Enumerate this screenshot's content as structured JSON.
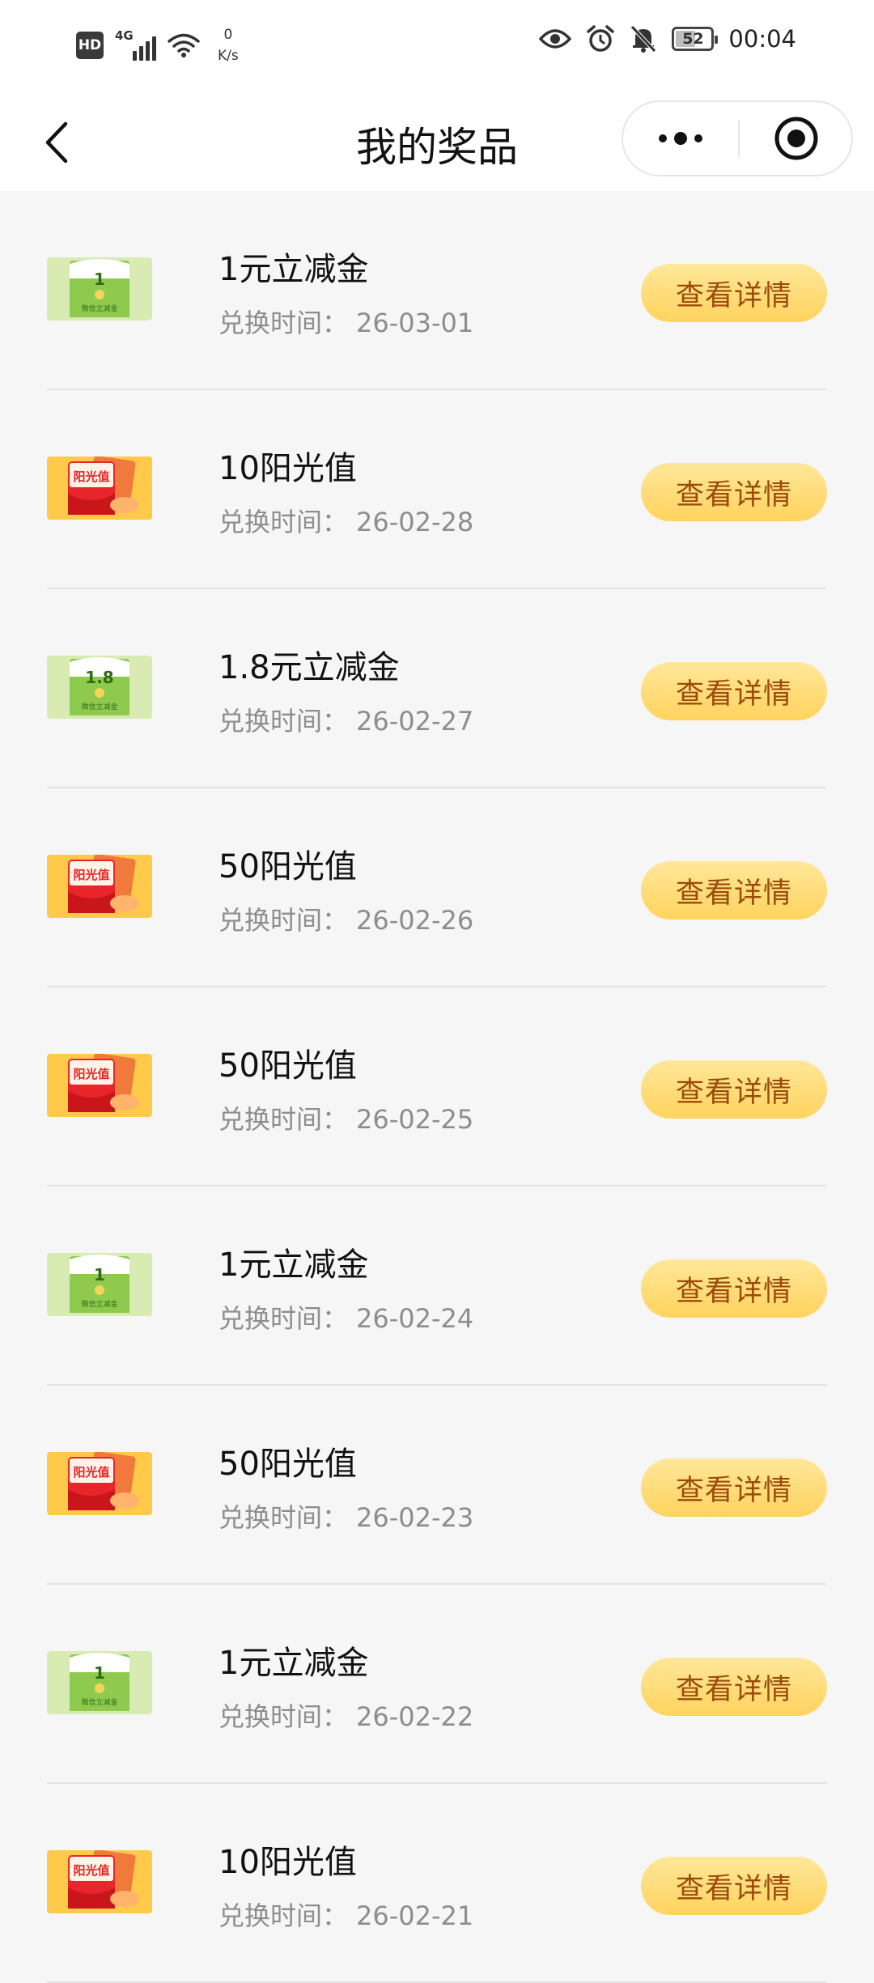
{
  "status_bar": {
    "hd": "HD",
    "network": "4G",
    "speed_value": "0",
    "speed_unit": "K/s",
    "battery": "52",
    "time": "00:04"
  },
  "nav": {
    "title": "我的奖品"
  },
  "labels": {
    "exchange_time": "兑换时间：",
    "detail_button": "查看详情"
  },
  "colors": {
    "button_bg": "#ffd35e",
    "button_text": "#9b4a0a",
    "page_bg": "#f6f6f6"
  },
  "prizes": [
    {
      "name": "1元立减金",
      "time": "26-03-01",
      "thumb_type": "green",
      "thumb_amount": "1",
      "thumb_caption": "微信立减金"
    },
    {
      "name": "10阳光值",
      "time": "26-02-28",
      "thumb_type": "orange",
      "thumb_label": "阳光值"
    },
    {
      "name": "1.8元立减金",
      "time": "26-02-27",
      "thumb_type": "green",
      "thumb_amount": "1.8",
      "thumb_caption": "微信立减金"
    },
    {
      "name": "50阳光值",
      "time": "26-02-26",
      "thumb_type": "orange",
      "thumb_label": "阳光值"
    },
    {
      "name": "50阳光值",
      "time": "26-02-25",
      "thumb_type": "orange",
      "thumb_label": "阳光值"
    },
    {
      "name": "1元立减金",
      "time": "26-02-24",
      "thumb_type": "green",
      "thumb_amount": "1",
      "thumb_caption": "微信立减金"
    },
    {
      "name": "50阳光值",
      "time": "26-02-23",
      "thumb_type": "orange",
      "thumb_label": "阳光值"
    },
    {
      "name": "1元立减金",
      "time": "26-02-22",
      "thumb_type": "green",
      "thumb_amount": "1",
      "thumb_caption": "微信立减金"
    },
    {
      "name": "10阳光值",
      "time": "26-02-21",
      "thumb_type": "orange",
      "thumb_label": "阳光值"
    }
  ]
}
